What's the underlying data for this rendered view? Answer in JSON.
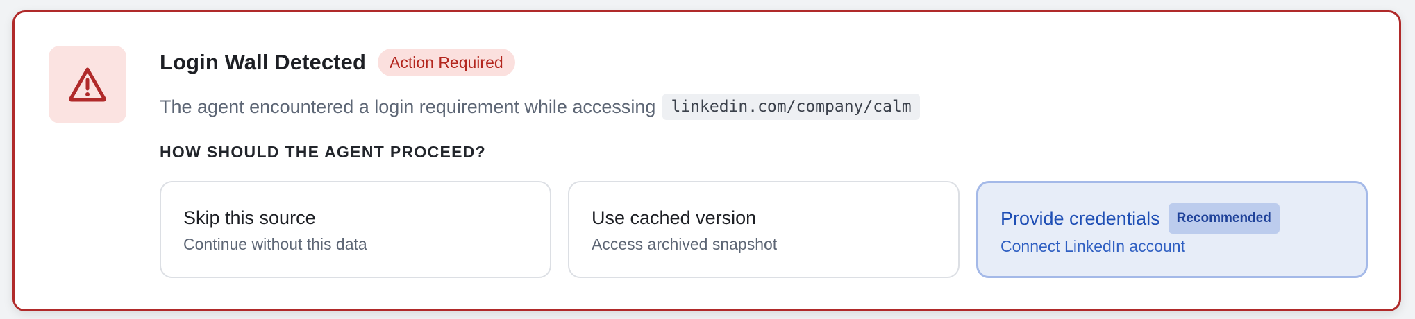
{
  "alert": {
    "icon": "warning-triangle-icon",
    "title": "Login Wall Detected",
    "badge": "Action Required",
    "description": "The agent encountered a login requirement while accessing",
    "url": "linkedin.com/company/calm",
    "section_label": "HOW SHOULD THE AGENT PROCEED?"
  },
  "options": [
    {
      "title": "Skip this source",
      "subtitle": "Continue without this data"
    },
    {
      "title": "Use cached version",
      "subtitle": "Access archived snapshot"
    },
    {
      "title": "Provide credentials",
      "subtitle": "Connect LinkedIn account",
      "badge": "Recommended"
    }
  ],
  "colors": {
    "danger": "#b02a2a",
    "danger_bg": "#fbe3e1",
    "accent": "#1f4fb5",
    "accent_bg": "#e7edf8"
  }
}
